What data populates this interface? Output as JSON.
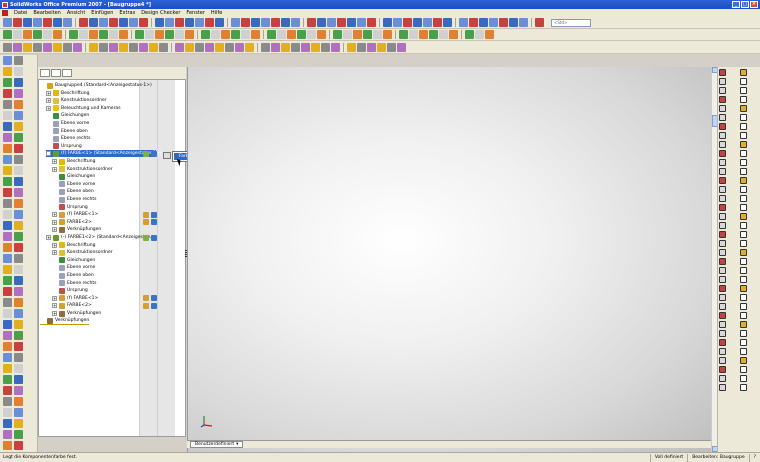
{
  "window": {
    "title": "SolidWorks Office Premium 2007 - [Baugruppe4 *]",
    "buttons": [
      "_",
      "□",
      "×"
    ]
  },
  "menu": {
    "items": [
      "Datei",
      "Bearbeiten",
      "Ansicht",
      "Einfügen",
      "Extras",
      "Design Checker",
      "Fenster",
      "Hilfe"
    ]
  },
  "toolbar": {
    "combo_value": "<Std>"
  },
  "tree": {
    "rows": [
      {
        "label": "Baugruppe4  (Standard<Anzeigestatus-1>)",
        "indent": 0,
        "icon": "assembly-icon",
        "plus": false
      },
      {
        "label": "Beschriftung",
        "indent": 1,
        "icon": "annotation-icon",
        "plus": true
      },
      {
        "label": "Konstruktionsordner",
        "indent": 1,
        "icon": "design-binder-icon",
        "plus": true
      },
      {
        "label": "Beleuchtung und Kameras",
        "indent": 1,
        "icon": "lights-icon",
        "plus": true
      },
      {
        "label": "Gleichungen",
        "indent": 1,
        "icon": "equations-icon",
        "plus": false
      },
      {
        "label": "Ebene vorne",
        "indent": 1,
        "icon": "plane-icon",
        "plus": false
      },
      {
        "label": "Ebene oben",
        "indent": 1,
        "icon": "plane-icon",
        "plus": false
      },
      {
        "label": "Ebene rechts",
        "indent": 1,
        "icon": "plane-icon",
        "plus": false
      },
      {
        "label": "Ursprung",
        "indent": 1,
        "icon": "origin-icon",
        "plus": false
      },
      {
        "label": "(f) FARBE<1> (Standard<Anzeigestatus-1>)",
        "indent": 1,
        "icon": "subassembly-icon",
        "plus": true,
        "selected": true
      },
      {
        "label": "Beschriftung",
        "indent": 2,
        "icon": "annotation-icon",
        "plus": true
      },
      {
        "label": "Konstruktionsordner",
        "indent": 2,
        "icon": "design-binder-icon",
        "plus": true
      },
      {
        "label": "Gleichungen",
        "indent": 2,
        "icon": "equations-icon",
        "plus": false
      },
      {
        "label": "Ebene vorne",
        "indent": 2,
        "icon": "plane-icon",
        "plus": false
      },
      {
        "label": "Ebene oben",
        "indent": 2,
        "icon": "plane-icon",
        "plus": false
      },
      {
        "label": "Ebene rechts",
        "indent": 2,
        "icon": "plane-icon",
        "plus": false
      },
      {
        "label": "Ursprung",
        "indent": 2,
        "icon": "origin-icon",
        "plus": false
      },
      {
        "label": "(f) FARBE<1>",
        "indent": 2,
        "icon": "part-icon",
        "plus": true
      },
      {
        "label": "FARBE<2>",
        "indent": 2,
        "icon": "part-icon",
        "plus": true
      },
      {
        "label": "Verknüpfungen",
        "indent": 2,
        "icon": "mates-icon",
        "plus": true
      },
      {
        "label": "(-) FARBE1<2> (Standard<Anzeigestatus",
        "indent": 1,
        "icon": "subassembly-icon",
        "plus": true
      },
      {
        "label": "Beschriftung",
        "indent": 2,
        "icon": "annotation-icon",
        "plus": true
      },
      {
        "label": "Konstruktionsordner",
        "indent": 2,
        "icon": "design-binder-icon",
        "plus": true
      },
      {
        "label": "Gleichungen",
        "indent": 2,
        "icon": "equations-icon",
        "plus": false
      },
      {
        "label": "Ebene vorne",
        "indent": 2,
        "icon": "plane-icon",
        "plus": false
      },
      {
        "label": "Ebene oben",
        "indent": 2,
        "icon": "plane-icon",
        "plus": false
      },
      {
        "label": "Ebene rechts",
        "indent": 2,
        "icon": "plane-icon",
        "plus": false
      },
      {
        "label": "Ursprung",
        "indent": 2,
        "icon": "origin-icon",
        "plus": false
      },
      {
        "label": "(f) FARBE<1>",
        "indent": 2,
        "icon": "part-icon",
        "plus": true
      },
      {
        "label": "FARBE<2>",
        "indent": 2,
        "icon": "part-icon",
        "plus": true
      },
      {
        "label": "Verknüpfungen",
        "indent": 2,
        "icon": "mates-icon",
        "plus": true
      },
      {
        "label": "Verknüpfungen",
        "indent": 0,
        "icon": "mates-icon",
        "plus": false,
        "underline": true
      }
    ]
  },
  "context_menu": {
    "item": "Farbe..."
  },
  "sheet_tabs": {
    "active": "Benutzerdefiniert"
  },
  "status": {
    "message": "Legt die Komponentenfarbe fest.",
    "state": "Voll definiert",
    "mode": "Bearbeiten: Baugruppe"
  }
}
